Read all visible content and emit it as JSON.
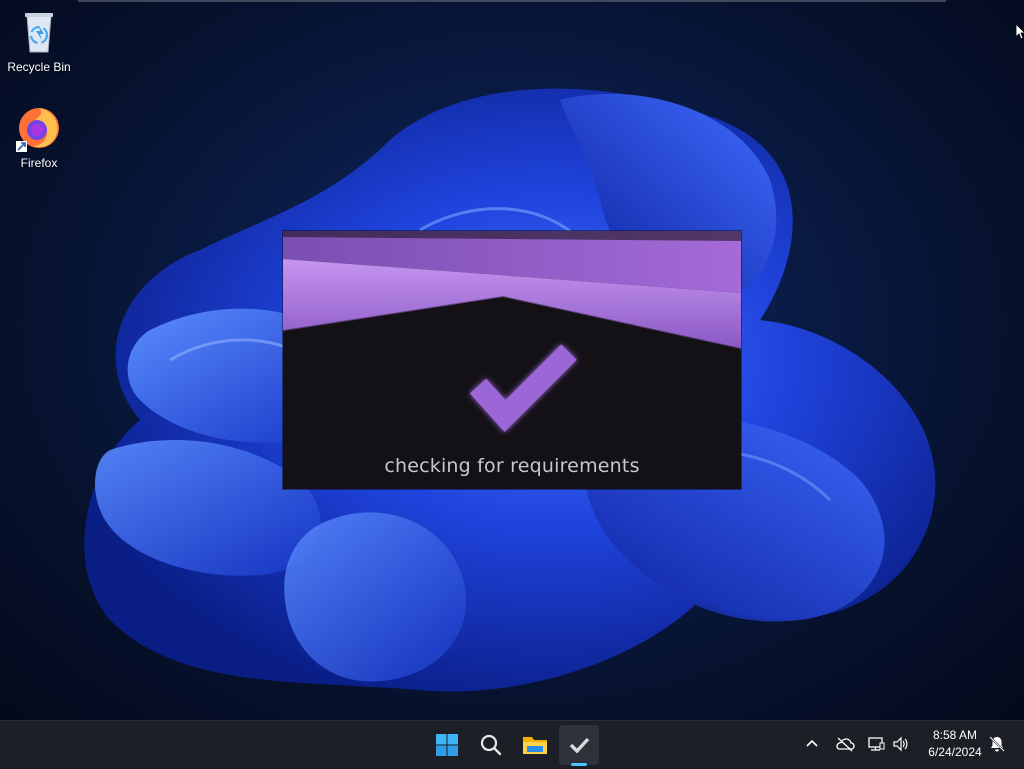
{
  "desktop": {
    "icons": [
      {
        "label": "Recycle Bin",
        "icon": "recycle-bin-icon"
      },
      {
        "label": "Firefox",
        "icon": "firefox-icon"
      }
    ]
  },
  "splash": {
    "message": "checking for requirements",
    "icon": "checkmark-icon",
    "accent": "#9b66d6",
    "background": "#131116"
  },
  "taskbar": {
    "apps": [
      {
        "name": "Start",
        "icon": "windows-start-icon"
      },
      {
        "name": "Search",
        "icon": "search-icon"
      },
      {
        "name": "File Explorer",
        "icon": "folder-icon"
      },
      {
        "name": "Requirements Checker",
        "icon": "checkmark-icon",
        "active": true
      }
    ],
    "tray": {
      "icons": [
        "chevron-up-icon",
        "onedrive-offline-icon",
        "network-icon",
        "volume-icon",
        "notification-icon"
      ],
      "time": "8:58 AM",
      "date": "6/24/2024"
    }
  }
}
